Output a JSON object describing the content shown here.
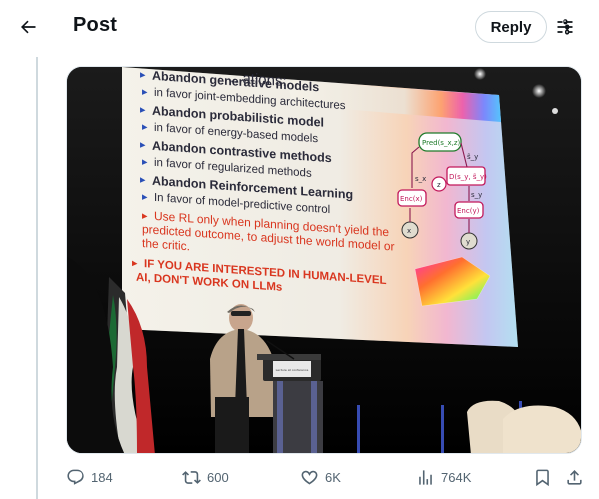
{
  "header": {
    "title": "Post",
    "reply_label": "Reply"
  },
  "media": {
    "slide_heading": "...ations:",
    "slide_items": [
      {
        "head": "Abandon generative models",
        "sub": "in favor joint-embedding architectures"
      },
      {
        "head": "Abandon probabilistic model",
        "sub": "in favor of energy-based models"
      },
      {
        "head": "Abandon contrastive methods",
        "sub": "in favor of regularized methods"
      },
      {
        "head": "Abandon Reinforcement Learning",
        "sub": "In favor of model-predictive control"
      }
    ],
    "slide_red_note_lines": [
      "Use RL only when planning doesn't yield the",
      "predicted outcome, to adjust the world model or",
      "the critic."
    ],
    "slide_callout_lines": [
      "IF YOU ARE INTERESTED IN HUMAN-LEVEL",
      "AI, DON'T WORK ON LLMs"
    ],
    "diagram_labels": {
      "pred": "Pred(s_x,z)",
      "d": "D(s_y, s̃_y)",
      "enc_x": "Enc(x)",
      "enc_y": "Enc(y)",
      "x": "x",
      "y": "y",
      "z": "z",
      "sx": "s_x",
      "sy": "s_y",
      "sy_hat": "s̃_y"
    },
    "podium_text": "Lecture at conference"
  },
  "actions": {
    "replies": "184",
    "reposts": "600",
    "likes": "6K",
    "views": "764K"
  },
  "colors": {
    "text_primary": "#0f1419",
    "text_secondary": "#536471",
    "border": "#cfd9de",
    "slide_red": "#d9361f",
    "slide_dark": "#2b2b3a",
    "bullet_blue": "#2a4fb7"
  }
}
